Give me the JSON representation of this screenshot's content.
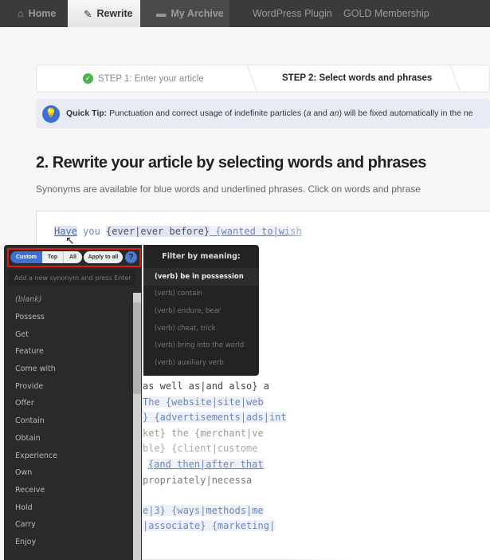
{
  "nav": {
    "tabs": [
      {
        "label": "Home",
        "icon": "home-icon"
      },
      {
        "label": "Rewrite",
        "icon": "pencil-icon",
        "active": true
      },
      {
        "label": "My Archive",
        "icon": "archive-icon"
      },
      {
        "label": "WordPress Plugin"
      },
      {
        "label": "GOLD Membership"
      }
    ]
  },
  "steps": {
    "step1": "STEP 1: Enter your article",
    "step2": "STEP 2: Select words and phrases"
  },
  "tip": {
    "label": "Quick Tip:",
    "text1": " Punctuation and correct usage of indefinite particles (",
    "a": "a",
    "and": " and ",
    "an": "an",
    "text2": ") will be fixed automatically in the ne"
  },
  "heading": "2. Rewrite your article by selecting words and phrases",
  "subtitle": "Synonyms are available for blue words and underlined phrases. Click on words and phrase",
  "editor": {
    "line1": {
      "word": "Have",
      "rest": " you ",
      "g1": "{ever|ever before}",
      "g2": " {wanted to|wish"
    },
    "lines": [
      "as well as|and also} a",
      "The {website|site|web",
      "} {advertisements|ads|int",
      "ket} the {merchant|ve",
      "ble} {client|custome",
      "{and then|after that",
      "propriately|necessa",
      "e|3} {ways|methods|me",
      "|associate} {marketing|"
    ]
  },
  "popup": {
    "modes": [
      "Custom",
      "Top",
      "All"
    ],
    "active_mode": "Custom",
    "apply_all": "Apply to all",
    "help": "?",
    "add_placeholder": "Add a new synonym and press Enter",
    "synonyms": [
      "(blank)",
      "Possess",
      "Get",
      "Feature",
      "Come with",
      "Provide",
      "Offer",
      "Contain",
      "Obtain",
      "Experience",
      "Own",
      "Receive",
      "Hold",
      "Carry",
      "Enjoy"
    ],
    "filter_title": "Filter by meaning:",
    "meanings": [
      "(verb) be in possession",
      "(verb) contain",
      "(verb) endure, bear",
      "(verb) cheat, trick",
      "(verb) bring into the world",
      "(verb) auxiliary verb"
    ],
    "selected_meaning": "(verb) be in possession"
  },
  "colors": {
    "accent": "#3f6fd1",
    "highlight": "#e01919",
    "popup_bg": "#2a2a2b"
  }
}
